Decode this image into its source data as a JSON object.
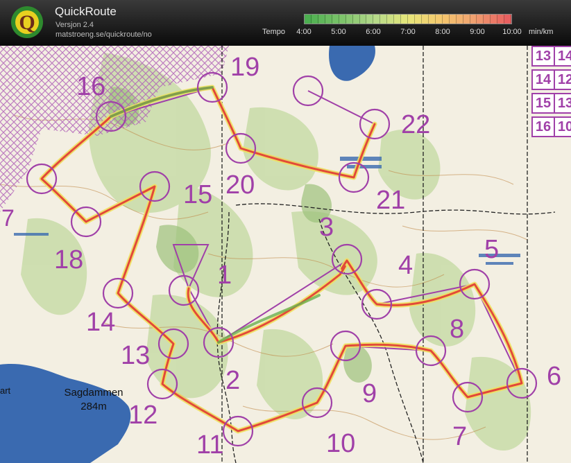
{
  "header": {
    "title": "QuickRoute",
    "version": "Versjon 2.4",
    "url": "matstroeng.se/quickroute/no",
    "logo_letter": "Q",
    "logo_icon": "quickroute-logo-icon"
  },
  "pace_legend": {
    "label": "Tempo",
    "ticks": [
      "4:00",
      "5:00",
      "6:00",
      "7:00",
      "8:00",
      "9:00",
      "10:00"
    ],
    "unit": "min/km",
    "colors": [
      "#4caf50",
      "#7cc36a",
      "#b4d98a",
      "#e6e67a",
      "#f5c86e",
      "#f0a070",
      "#e86060"
    ]
  },
  "map": {
    "course_color": "#a040a8",
    "route_color": "#e03030",
    "lake_label": "Sagdammen",
    "lake_elevation": "284m",
    "edge_label_left": "art",
    "edge_label_left_number": "7",
    "controls": [
      "1",
      "2",
      "3",
      "4",
      "5",
      "6",
      "7",
      "8",
      "9",
      "10",
      "11",
      "12",
      "13",
      "14",
      "15",
      "16",
      "18",
      "19",
      "20",
      "21",
      "22"
    ],
    "description_grid": [
      [
        "13",
        "14"
      ],
      [
        "14",
        "12"
      ],
      [
        "15",
        "13"
      ],
      [
        "16",
        "10"
      ]
    ]
  }
}
